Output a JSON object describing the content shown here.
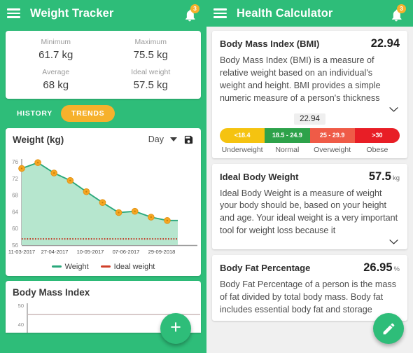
{
  "left": {
    "appbar": {
      "title": "Weight Tracker",
      "menu_icon": "hamburger-icon",
      "bell_icon": "bell-icon",
      "badge": "3"
    },
    "summary": {
      "cells": [
        {
          "label": "Minimum",
          "value": "61.7 kg"
        },
        {
          "label": "Maximum",
          "value": "75.5 kg"
        },
        {
          "label": "Average",
          "value": "68 kg"
        },
        {
          "label": "Ideal weight",
          "value": "57.5 kg"
        }
      ]
    },
    "tabs": [
      {
        "label": "HISTORY",
        "active": false
      },
      {
        "label": "TRENDS",
        "active": true
      }
    ],
    "chart_card": {
      "title": "Weight (kg)",
      "period": "Day",
      "caret_icon": "chevron-down-icon",
      "save_icon": "save-icon"
    },
    "bmi_card": {
      "title": "Body Mass Index"
    },
    "fab": {
      "icon": "plus-icon",
      "label": "+"
    }
  },
  "right": {
    "appbar": {
      "title": "Health Calculator",
      "menu_icon": "hamburger-icon",
      "bell_icon": "bell-icon",
      "badge": "3"
    },
    "cards": [
      {
        "title": "Body Mass Index (BMI)",
        "value": "22.94",
        "unit": "",
        "description": "Body Mass Index (BMI) is a measure of relative weight based on an individual's weight and height. BMI provides a simple numeric measure of a person's thickness",
        "expand_icon": "chevron-down-icon"
      },
      {
        "title": "Ideal Body Weight",
        "value": "57.5",
        "unit": "kg",
        "description": "Ideal Body Weight is a measure of weight your body should be, based on your height and age. Your ideal weight is a very important tool for weight loss because it",
        "expand_icon": "chevron-down-icon"
      },
      {
        "title": "Body Fat Percentage",
        "value": "26.95",
        "unit": "%",
        "description": "Body Fat Percentage of a person is the mass of fat divided by total body mass. Body fat includes essential body fat and storage",
        "expand_icon": "chevron-down-icon"
      }
    ],
    "bmi_scale": {
      "marker": "22.94",
      "segments": [
        {
          "range": "<18.4",
          "label": "Underweight",
          "color": "#f5c310"
        },
        {
          "range": "18.5 - 24.9",
          "label": "Normal",
          "color": "#2da24a"
        },
        {
          "range": "25 - 29.9",
          "label": "Overweight",
          "color": "#ef5b47"
        },
        {
          "range": ">30",
          "label": "Obese",
          "color": "#e81e26"
        }
      ]
    },
    "fab": {
      "icon": "pencil-icon"
    }
  },
  "chart_data": {
    "type": "line",
    "title": "Weight (kg)",
    "xlabel": "",
    "ylabel": "Weight (kg)",
    "ylim": [
      56,
      77.5
    ],
    "yticks": [
      56,
      60,
      64,
      68,
      72,
      76
    ],
    "xtick_labels": [
      "11-03-2017",
      "27-04-2017",
      "10-05-2017",
      "07-06-2017",
      "29-09-2018"
    ],
    "grid": false,
    "legend_position": "bottom",
    "series": [
      {
        "name": "Weight",
        "color": "#2aa87b",
        "marker_color": "#f5a623",
        "fill": "#b6e6ce",
        "x": [
          0,
          1,
          2,
          3,
          4,
          5,
          6,
          7,
          8,
          9,
          10
        ],
        "values": [
          74.2,
          75.6,
          73.1,
          71.3,
          68.6,
          66.0,
          63.6,
          63.9,
          62.5,
          61.7,
          61.7
        ]
      },
      {
        "name": "Ideal weight",
        "color": "#d0402a",
        "style": "dotted",
        "constant": 57.5
      }
    ],
    "legend": [
      "Weight",
      "Ideal weight"
    ]
  },
  "chart_data_bmi": {
    "type": "line",
    "title": "Body Mass Index",
    "yticks": [
      50,
      40
    ],
    "ylim": [
      36,
      52
    ],
    "grid": false
  }
}
